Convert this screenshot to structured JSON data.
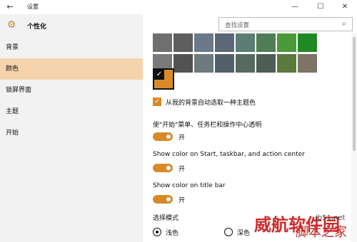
{
  "window": {
    "title": "设置",
    "back_icon": "arrow-left-icon",
    "min_glyph": "—",
    "max_glyph": "☐",
    "close_glyph": "✕"
  },
  "sidebar": {
    "title": "个性化",
    "items": [
      {
        "label": "背景",
        "active": false
      },
      {
        "label": "颜色",
        "active": true
      },
      {
        "label": "锁屏界面",
        "active": false
      },
      {
        "label": "主题",
        "active": false
      },
      {
        "label": "开始",
        "active": false
      }
    ]
  },
  "search": {
    "placeholder": "查找设置"
  },
  "palette": {
    "selected_color": "#d88a29",
    "row1": [
      "#6f6f6f",
      "#5e5e5e",
      "#6a7a8a",
      "#5c6878",
      "#5b7d73",
      "#4f7d55",
      "#4a9a3a",
      "#1f8a25"
    ],
    "row2": [
      "#7a7a7a",
      "#525252",
      "#6d7a80",
      "#53606a",
      "#566a62",
      "#4d5e55",
      "#5a7a3e",
      "#7d7466"
    ]
  },
  "auto_pick": {
    "label": "从我的背景自动选取一种主题色",
    "checked": true
  },
  "settings": [
    {
      "label": "使\"开始\"菜单、任务栏和操作中心透明",
      "state": "开"
    },
    {
      "label": "Show color on Start, taskbar, and action center",
      "state": "开"
    },
    {
      "label": "Show color on title bar",
      "state": "开"
    }
  ],
  "mode": {
    "label": "选择模式",
    "options": [
      {
        "label": "浅色",
        "selected": true
      },
      {
        "label": "深色",
        "selected": false
      }
    ]
  },
  "watermark": {
    "text1": "威航软件园",
    "text2": "jb51.net",
    "text3": "脚本之家"
  }
}
